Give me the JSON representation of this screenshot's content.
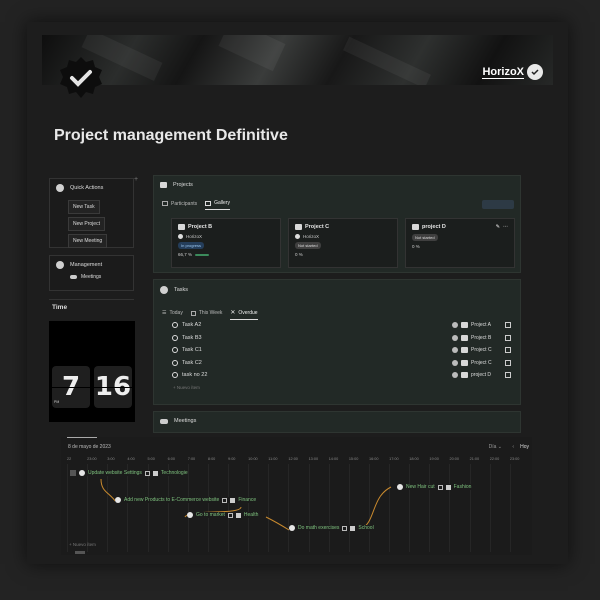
{
  "brand": {
    "name": "HorizoX"
  },
  "page": {
    "title": "Project management Definitive"
  },
  "quick_actions": {
    "title": "Quick Actions",
    "buttons": [
      "New Task",
      "New Project",
      "New Meeting"
    ]
  },
  "management": {
    "title": "Management",
    "items": [
      "Meetings"
    ]
  },
  "time": {
    "label": "Time",
    "hour": "7",
    "minute": "16",
    "ampm": "PM"
  },
  "projects": {
    "title": "Projects",
    "tabs": [
      "Participants",
      "Gallery"
    ],
    "active_tab": "Gallery",
    "cards": [
      {
        "name": "Project B",
        "owner": "HorizoX",
        "status": "In progress",
        "progress": "66,7 %"
      },
      {
        "name": "Project C",
        "owner": "HorizoX",
        "status": "Not started",
        "progress": "0 %"
      },
      {
        "name": "project D",
        "status": "Not started",
        "progress": "0 %"
      }
    ]
  },
  "tasks": {
    "title": "Tasks",
    "tabs": [
      "Today",
      "This Week",
      "Overdue"
    ],
    "active_tab": "Overdue",
    "rows": [
      {
        "name": "Task A2",
        "project": "Project A"
      },
      {
        "name": "Task B3",
        "project": "Project B"
      },
      {
        "name": "Task C1",
        "project": "Project C"
      },
      {
        "name": "Task C2",
        "project": "Project C"
      },
      {
        "name": "task no 22",
        "project": "project D"
      }
    ],
    "new_item": "+ Nuevo ítem"
  },
  "meetings": {
    "title": "Meetings"
  },
  "timeline": {
    "date": "8 de mayo de 2023",
    "view": "Día",
    "today": "Hoy",
    "hours": [
      "22",
      "23:00",
      "3:00",
      "4:00",
      "5:00",
      "6:00",
      "7:00",
      "8:00",
      "9:00",
      "10:00",
      "11:00",
      "12:00",
      "13:00",
      "14:00",
      "15:00",
      "16:00",
      "17:00",
      "18:00",
      "19:00",
      "20:00",
      "21:00",
      "22:00",
      "23:00"
    ],
    "events": [
      {
        "name": "Update website Settings",
        "tag": "Technologie"
      },
      {
        "name": "Add new Products to E-Commerce website",
        "tag": "Finance"
      },
      {
        "name": "Go to market",
        "tag": "Health"
      },
      {
        "name": "Do math exercises",
        "tag": "School"
      },
      {
        "name": "New Hair cut",
        "tag": "Fashion"
      }
    ],
    "new_item": "+ Nuevo ítem"
  }
}
